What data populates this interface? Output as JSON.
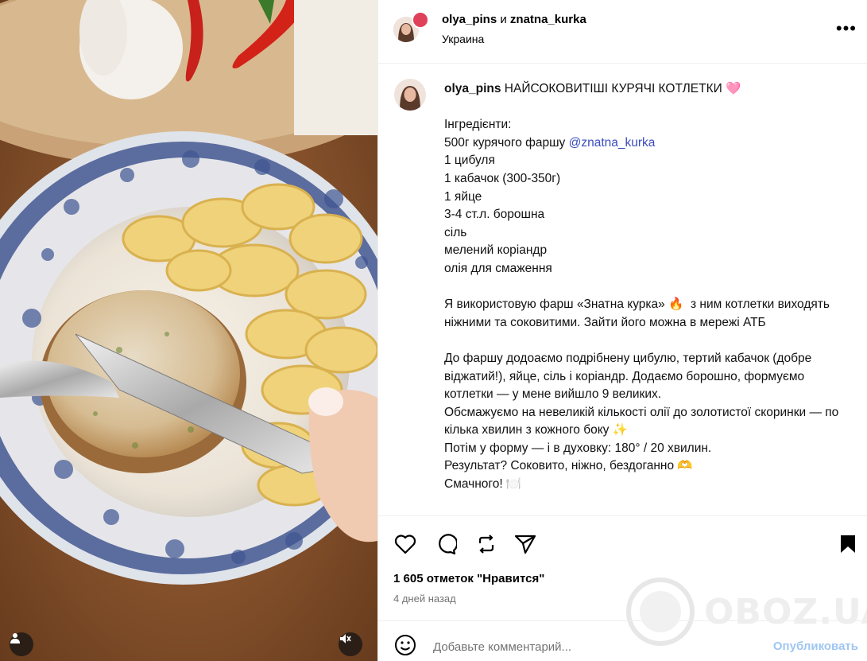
{
  "header": {
    "user1": "olya_pins",
    "and": " и ",
    "user2": "znatna_kurka",
    "location": "Украина",
    "more": "•••"
  },
  "caption": {
    "user": "olya_pins",
    "title": " НАЙСОКОВИТІШІ КУРЯЧІ КОТЛЕТКИ 🩷",
    "ingredients_label": "Інгредієнти:",
    "line_minced": "500г курячого фаршу ",
    "mention": "@znatna_kurka",
    "ingredients": [
      "1 цибуля",
      "1 кабачок (300-350г)",
      "1 яйце",
      "3-4 ст.л. борошна",
      "сіль",
      "мелений коріандр",
      "олія для смаження"
    ],
    "paragraph2": "Я використовую фарш «Знатна курка» 🔥  з ним котлетки виходять ніжними та соковитими. Зайти його можна в мережі АТБ",
    "paragraph3": "До фаршу додоаємо подрібнену цибулю, тертий кабачок (добре віджатий!), яйце, сіль і коріандр. Додаємо борошно, формуємо котлетки — у мене вийшло 9 великих.\nОбсмажуємо на невеликій кількості олії до золотистої скоринки — по кілька хвилин з кожного боку ✨\nПотім у форму — і в духовку: 180° / 20 хвилин.\nРезультат? Соковито, ніжно, бездоганно 🫶\nСмачного! 🍽️"
  },
  "likes": "1 605 отметок \"Нравится\"",
  "time": "4 дней назад",
  "comment": {
    "placeholder": "Добавьте комментарий...",
    "post": "Опубликовать"
  },
  "watermark": "OBOZ.UA",
  "colors": {
    "mention": "#3b4cc0",
    "post_button": "#9fc6f2",
    "muted": "#737373",
    "divider": "#efefef"
  },
  "icons": [
    "heart-icon",
    "comment-icon",
    "repost-icon",
    "share-icon",
    "bookmark-icon",
    "emoji-icon",
    "user-icon",
    "mute-icon",
    "more-icon"
  ]
}
